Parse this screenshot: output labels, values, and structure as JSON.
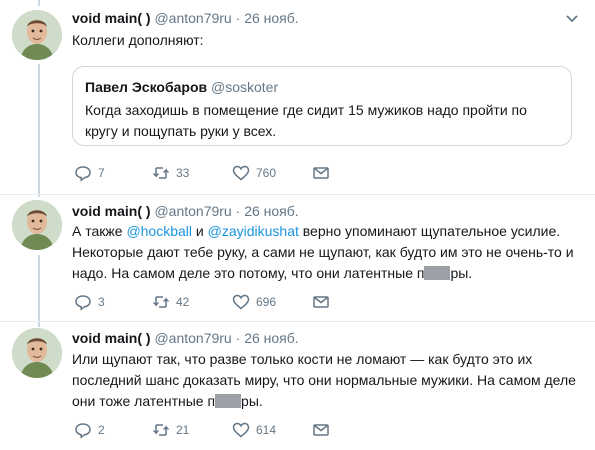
{
  "tweets": [
    {
      "author_name": "void main( )",
      "handle": "@anton79ru",
      "dot": "·",
      "date": "26 нояб.",
      "text": "Коллеги дополняют:",
      "quote": {
        "author_name": "Павел Эскобаров",
        "handle": "@soskoter",
        "text": "Когда заходишь в помещение где сидит 15 мужиков  надо пройти по кругу и пощупать руки у всех."
      },
      "replies": "7",
      "retweets": "33",
      "likes": "760"
    },
    {
      "author_name": "void main( )",
      "handle": "@anton79ru",
      "dot": "·",
      "date": "26 нояб.",
      "text_before": "А также ",
      "mention1": "@hockball",
      "text_and": " и ",
      "mention2": "@zayidikushat",
      "text_main": " верно упоминают щупательное усилие. Некоторые дают тебе руку, а сами не щупают, как будто им это не очень-то и надо. На самом деле это потому, что они латентные п",
      "text_end": "ры.",
      "replies": "3",
      "retweets": "42",
      "likes": "696"
    },
    {
      "author_name": "void main( )",
      "handle": "@anton79ru",
      "dot": "·",
      "date": "26 нояб.",
      "text_main": "Или щупают так, что разве только кости не ломают — как будто это их последний шанс доказать миру, что они нормальные мужики. На самом деле они тоже латентные п",
      "text_end": "ры.",
      "replies": "2",
      "retweets": "21",
      "likes": "614"
    }
  ],
  "icons": {
    "reply": "reply-icon",
    "retweet": "retweet-icon",
    "like": "heart-icon",
    "message": "envelope-icon",
    "menu": "chevron-down-icon"
  },
  "colors": {
    "link": "#1b95e0",
    "muted": "#657786",
    "thread_line": "#cdd8e0",
    "border": "#e6ecf0"
  }
}
